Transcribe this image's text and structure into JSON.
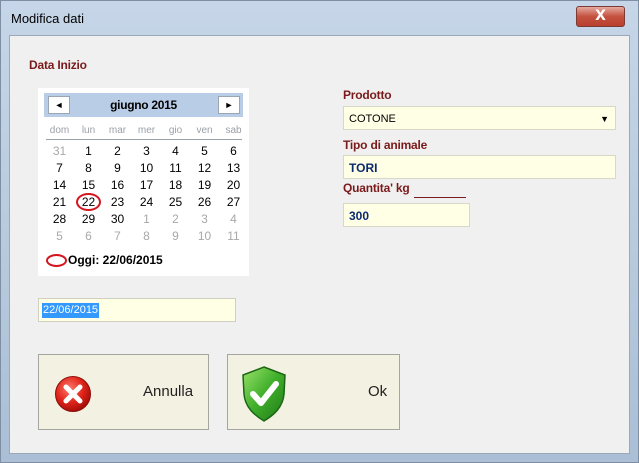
{
  "window": {
    "title": "Modifica dati",
    "close_glyph": "X"
  },
  "data_inizio": {
    "label": "Data Inizio",
    "calendar": {
      "month_label": "giugno 2015",
      "prev_glyph": "◄",
      "next_glyph": "►",
      "weekdays": [
        "dom",
        "lun",
        "mar",
        "mer",
        "gio",
        "ven",
        "sab"
      ],
      "weeks": [
        [
          "31",
          "1",
          "2",
          "3",
          "4",
          "5",
          "6"
        ],
        [
          "7",
          "8",
          "9",
          "10",
          "11",
          "12",
          "13"
        ],
        [
          "14",
          "15",
          "16",
          "17",
          "18",
          "19",
          "20"
        ],
        [
          "21",
          "22",
          "23",
          "24",
          "25",
          "26",
          "27"
        ],
        [
          "28",
          "29",
          "30",
          "1",
          "2",
          "3",
          "4"
        ],
        [
          "5",
          "6",
          "7",
          "8",
          "9",
          "10",
          "11"
        ]
      ],
      "selected_day": "22",
      "today_text": "Oggi: 22/06/2015"
    },
    "date_value": "22/06/2015"
  },
  "prodotto": {
    "label": "Prodotto",
    "value": "COTONE"
  },
  "tipo_animale": {
    "label": "Tipo di animale",
    "value": "TORI"
  },
  "quantita": {
    "label": "Quantita' kg",
    "value": "300"
  },
  "buttons": {
    "annulla": {
      "label": "Annulla",
      "icon": "cancel-x-icon"
    },
    "ok": {
      "label": "Ok",
      "icon": "shield-check-icon"
    }
  },
  "colors": {
    "label_red": "#7a1a1a",
    "field_bg": "#ffffe6",
    "selection_blue": "#3399ff"
  }
}
